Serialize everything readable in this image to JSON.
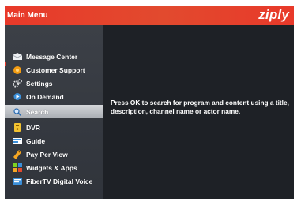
{
  "header": {
    "title": "Main Menu",
    "brand": "ziply"
  },
  "menu": {
    "items": [
      {
        "label": "Message Center",
        "icon": "envelope-icon"
      },
      {
        "label": "Customer Support",
        "icon": "support-icon"
      },
      {
        "label": "Settings",
        "icon": "gear-icon"
      },
      {
        "label": "On Demand",
        "icon": "on-demand-icon"
      },
      {
        "label": "Search",
        "icon": "search-icon",
        "selected": true
      },
      {
        "label": "DVR",
        "icon": "dvr-icon"
      },
      {
        "label": "Guide",
        "icon": "guide-icon"
      },
      {
        "label": "Pay Per View",
        "icon": "pay-per-view-icon"
      },
      {
        "label": "Widgets & Apps",
        "icon": "widgets-icon"
      },
      {
        "label": "FiberTV Digital Voice",
        "icon": "digital-voice-icon"
      }
    ]
  },
  "content": {
    "description": "Press OK to search for program and content using a title, description, channel name or actor name."
  },
  "colors": {
    "accent": "#e8392a",
    "background": "#24272d",
    "selected": "#c0c3c7"
  }
}
